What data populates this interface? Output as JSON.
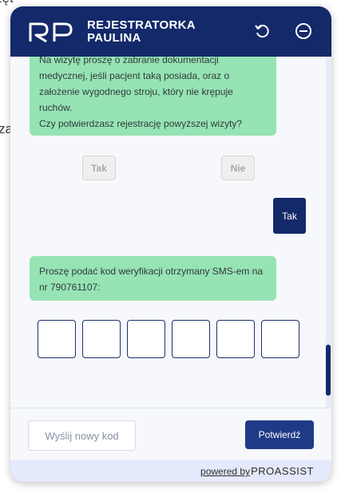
{
  "background": {
    "text_top": "zęt",
    "text_mid": "za"
  },
  "header": {
    "logo_text": "RP",
    "title_line1": "REJESTRATORKA",
    "title_line2": "PAULINA",
    "refresh_icon": "refresh-icon",
    "minimize_icon": "minimize-icon"
  },
  "chat": {
    "bubble1_text": "Na wizytę proszę o zabranie dokumentacji\nmedycznej, jeśli pacjent taką posiada, oraz o\nzałożenie wygodnego stroju, który nie krępuje\nruchów.\nCzy potwierdzasz rejestrację powyższej wizyty?",
    "choice_yes": "Tak",
    "choice_no": "Nie",
    "user_reply": "Tak",
    "bubble2_text": "Proszę podać kod weryfikacji otrzymany SMS-em na\nnr 790761107:",
    "code_boxes": [
      "",
      "",
      "",
      "",
      "",
      ""
    ]
  },
  "footer": {
    "resend_label": "Wyślij nowy kod",
    "confirm_label": "Potwierdź"
  },
  "powered": {
    "text": "powered by",
    "brand": "PROASSIST"
  },
  "colors": {
    "header_bg": "#14296a",
    "bubble_bg": "#96e3b4",
    "confirm_bg": "#1f3a86"
  }
}
